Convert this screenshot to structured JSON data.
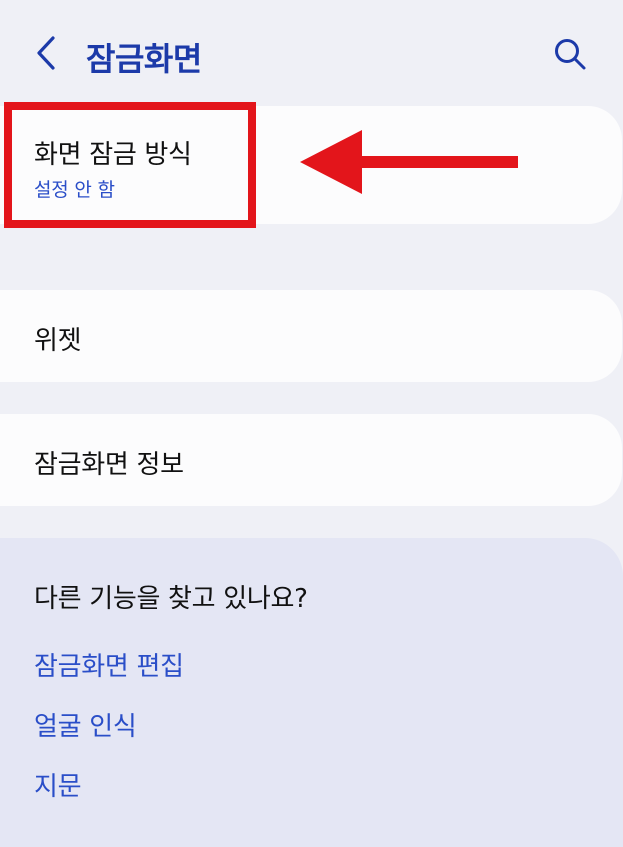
{
  "header": {
    "title": "잠금화면",
    "back_icon": "chevron-left-icon",
    "search_icon": "search-icon",
    "accent_color": "#1c3aa9"
  },
  "settings": {
    "lock_type": {
      "title": "화면 잠금 방식",
      "value": "설정 안 함"
    },
    "widgets": {
      "title": "위젯"
    },
    "lock_screen_info": {
      "title": "잠금화면 정보"
    }
  },
  "suggestions": {
    "heading": "다른 기능을 찾고 있나요?",
    "links": [
      "잠금화면 편집",
      "얼굴 인식",
      "지문"
    ]
  },
  "annotation": {
    "highlight_color": "#e3151b",
    "arrow_icon": "arrow-left-icon"
  }
}
